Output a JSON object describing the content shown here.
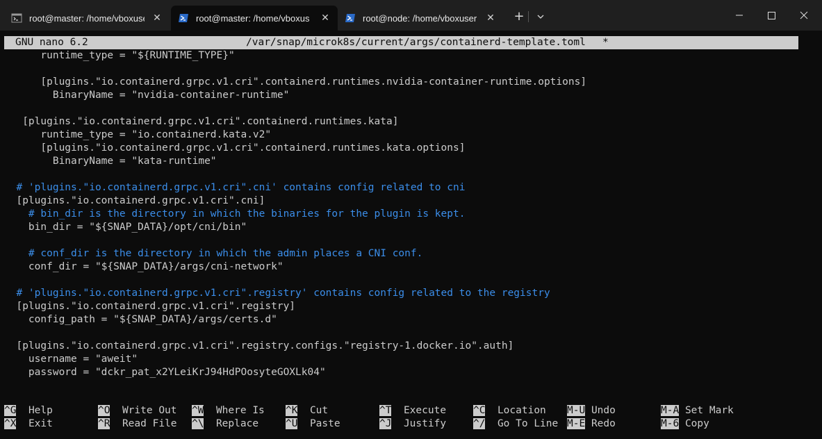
{
  "window": {
    "tabs": [
      {
        "title": "root@master: /home/vboxuse",
        "icon": "cmd-terminal-icon",
        "active": false
      },
      {
        "title": "root@master: /home/vboxuse",
        "icon": "powershell-icon",
        "active": true
      },
      {
        "title": "root@node: /home/vboxuser",
        "icon": "powershell-icon",
        "active": false
      }
    ],
    "new_tab_symbol": "+",
    "close_symbol": "✕"
  },
  "nano": {
    "version": "GNU nano 6.2",
    "file_path": "/var/snap/microk8s/current/args/containerd-template.toml",
    "modified_marker": "*"
  },
  "editor_lines": [
    {
      "text": "      runtime_type = \"${RUNTIME_TYPE}\"",
      "kind": "code"
    },
    {
      "text": "",
      "kind": "code"
    },
    {
      "text": "      [plugins.\"io.containerd.grpc.v1.cri\".containerd.runtimes.nvidia-container-runtime.options]",
      "kind": "code"
    },
    {
      "text": "        BinaryName = \"nvidia-container-runtime\"",
      "kind": "code"
    },
    {
      "text": "",
      "kind": "code"
    },
    {
      "text": "   [plugins.\"io.containerd.grpc.v1.cri\".containerd.runtimes.kata]",
      "kind": "code"
    },
    {
      "text": "      runtime_type = \"io.containerd.kata.v2\"",
      "kind": "code"
    },
    {
      "text": "      [plugins.\"io.containerd.grpc.v1.cri\".containerd.runtimes.kata.options]",
      "kind": "code"
    },
    {
      "text": "        BinaryName = \"kata-runtime\"",
      "kind": "code"
    },
    {
      "text": "",
      "kind": "code"
    },
    {
      "text": "  # 'plugins.\"io.containerd.grpc.v1.cri\".cni' contains config related to cni",
      "kind": "comment"
    },
    {
      "text": "  [plugins.\"io.containerd.grpc.v1.cri\".cni]",
      "kind": "code"
    },
    {
      "text": "    # bin_dir is the directory in which the binaries for the plugin is kept.",
      "kind": "comment"
    },
    {
      "text": "    bin_dir = \"${SNAP_DATA}/opt/cni/bin\"",
      "kind": "code"
    },
    {
      "text": "",
      "kind": "code"
    },
    {
      "text": "    # conf_dir is the directory in which the admin places a CNI conf.",
      "kind": "comment"
    },
    {
      "text": "    conf_dir = \"${SNAP_DATA}/args/cni-network\"",
      "kind": "code"
    },
    {
      "text": "",
      "kind": "code"
    },
    {
      "text": "  # 'plugins.\"io.containerd.grpc.v1.cri\".registry' contains config related to the registry",
      "kind": "comment"
    },
    {
      "text": "  [plugins.\"io.containerd.grpc.v1.cri\".registry]",
      "kind": "code"
    },
    {
      "text": "    config_path = \"${SNAP_DATA}/args/certs.d\"",
      "kind": "code"
    },
    {
      "text": "",
      "kind": "code"
    },
    {
      "text": "  [plugins.\"io.containerd.grpc.v1.cri\".registry.configs.\"registry-1.docker.io\".auth]",
      "kind": "code"
    },
    {
      "text": "    username = \"aweit\"",
      "kind": "code"
    },
    {
      "text": "    password = \"dckr_pat_x2YLeiKrJ94HdPOosyteGOXLk04\"",
      "kind": "code"
    }
  ],
  "shortcuts": [
    [
      {
        "key": "^G",
        "label": "Help"
      },
      {
        "key": "^O",
        "label": "Write Out"
      },
      {
        "key": "^W",
        "label": "Where Is"
      },
      {
        "key": "^K",
        "label": "Cut"
      },
      {
        "key": "^T",
        "label": "Execute"
      },
      {
        "key": "^C",
        "label": "Location"
      },
      {
        "key": "M-U",
        "label": "Undo"
      },
      {
        "key": "M-A",
        "label": "Set Mark"
      }
    ],
    [
      {
        "key": "^X",
        "label": "Exit"
      },
      {
        "key": "^R",
        "label": "Read File"
      },
      {
        "key": "^\\",
        "label": "Replace"
      },
      {
        "key": "^U",
        "label": "Paste"
      },
      {
        "key": "^J",
        "label": "Justify"
      },
      {
        "key": "^/",
        "label": "Go To Line"
      },
      {
        "key": "M-E",
        "label": "Redo"
      },
      {
        "key": "M-6",
        "label": "Copy"
      }
    ]
  ],
  "colors": {
    "background": "#0c0c0c",
    "foreground": "#cccccc",
    "comment": "#3b8eea",
    "titlebar": "#1f1f1f"
  }
}
